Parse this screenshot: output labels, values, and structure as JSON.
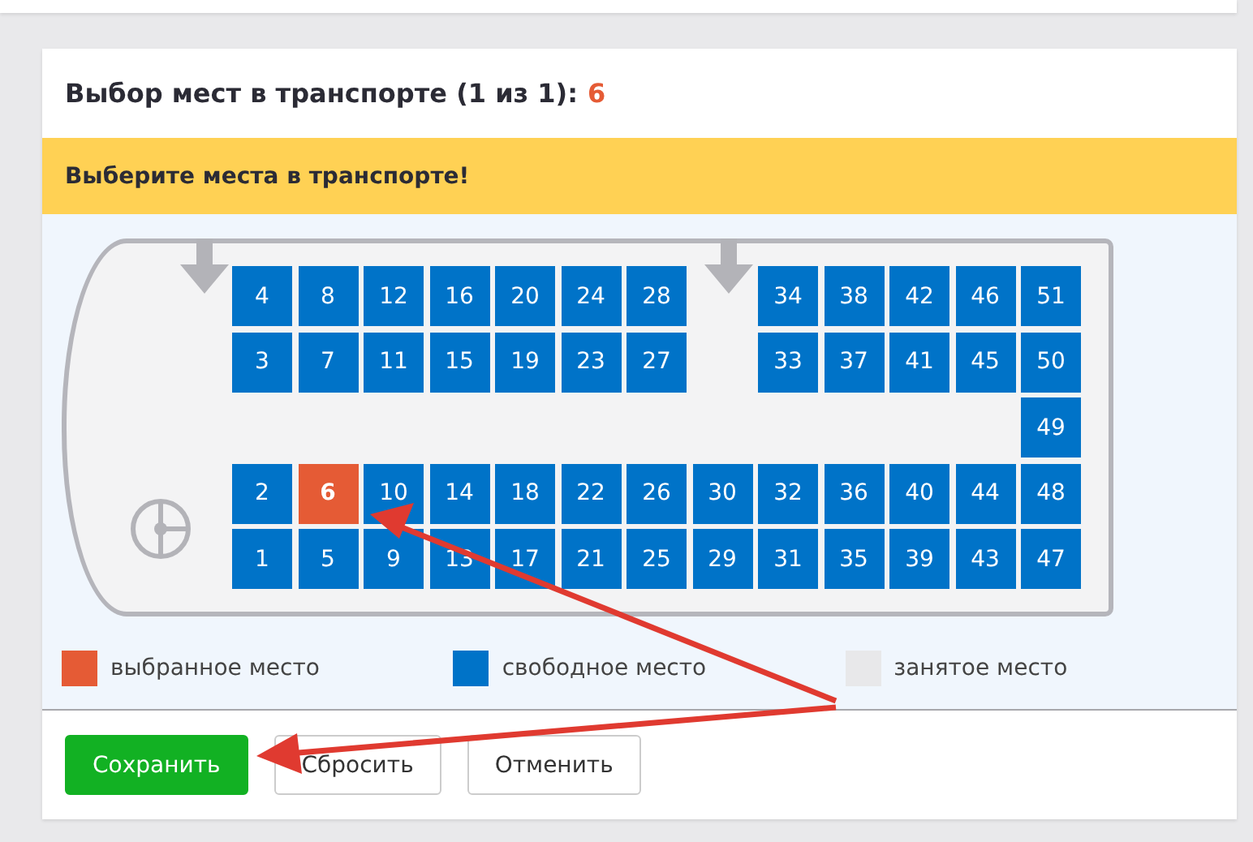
{
  "title": {
    "text": "Выбор мест в транспорте (1 из 1):",
    "count": "6"
  },
  "notice": "Выберите места в транспорте!",
  "seat_rows": [
    [
      {
        "label": "4",
        "selected": false
      },
      {
        "label": "8",
        "selected": false
      },
      {
        "label": "12",
        "selected": false
      },
      {
        "label": "16",
        "selected": false
      },
      {
        "label": "20",
        "selected": false
      },
      {
        "label": "24",
        "selected": false
      },
      {
        "label": "28",
        "selected": false
      },
      null,
      {
        "label": "34",
        "selected": false
      },
      {
        "label": "38",
        "selected": false
      },
      {
        "label": "42",
        "selected": false
      },
      {
        "label": "46",
        "selected": false
      },
      {
        "label": "51",
        "selected": false
      }
    ],
    [
      {
        "label": "3",
        "selected": false
      },
      {
        "label": "7",
        "selected": false
      },
      {
        "label": "11",
        "selected": false
      },
      {
        "label": "15",
        "selected": false
      },
      {
        "label": "19",
        "selected": false
      },
      {
        "label": "23",
        "selected": false
      },
      {
        "label": "27",
        "selected": false
      },
      null,
      {
        "label": "33",
        "selected": false
      },
      {
        "label": "37",
        "selected": false
      },
      {
        "label": "41",
        "selected": false
      },
      {
        "label": "45",
        "selected": false
      },
      {
        "label": "50",
        "selected": false
      }
    ],
    [
      null,
      null,
      null,
      null,
      null,
      null,
      null,
      null,
      null,
      null,
      null,
      null,
      {
        "label": "49",
        "selected": false
      }
    ],
    [
      {
        "label": "2",
        "selected": false
      },
      {
        "label": "6",
        "selected": true
      },
      {
        "label": "10",
        "selected": false
      },
      {
        "label": "14",
        "selected": false
      },
      {
        "label": "18",
        "selected": false
      },
      {
        "label": "22",
        "selected": false
      },
      {
        "label": "26",
        "selected": false
      },
      {
        "label": "30",
        "selected": false
      },
      {
        "label": "32",
        "selected": false
      },
      {
        "label": "36",
        "selected": false
      },
      {
        "label": "40",
        "selected": false
      },
      {
        "label": "44",
        "selected": false
      },
      {
        "label": "48",
        "selected": false
      }
    ],
    [
      {
        "label": "1",
        "selected": false
      },
      {
        "label": "5",
        "selected": false
      },
      {
        "label": "9",
        "selected": false
      },
      {
        "label": "13",
        "selected": false
      },
      {
        "label": "17",
        "selected": false
      },
      {
        "label": "21",
        "selected": false
      },
      {
        "label": "25",
        "selected": false
      },
      {
        "label": "29",
        "selected": false
      },
      {
        "label": "31",
        "selected": false
      },
      {
        "label": "35",
        "selected": false
      },
      {
        "label": "39",
        "selected": false
      },
      {
        "label": "43",
        "selected": false
      },
      {
        "label": "47",
        "selected": false
      }
    ]
  ],
  "legend": [
    {
      "label": "выбранное место",
      "color": "#e55b35"
    },
    {
      "label": "свободное место",
      "color": "#0073c8"
    },
    {
      "label": "занятое место",
      "color": "#e8e8ea"
    }
  ],
  "buttons": [
    {
      "label": "Сохранить",
      "kind": "primary"
    },
    {
      "label": "Сбросить",
      "kind": "secondary"
    },
    {
      "label": "Отменить",
      "kind": "secondary"
    }
  ]
}
